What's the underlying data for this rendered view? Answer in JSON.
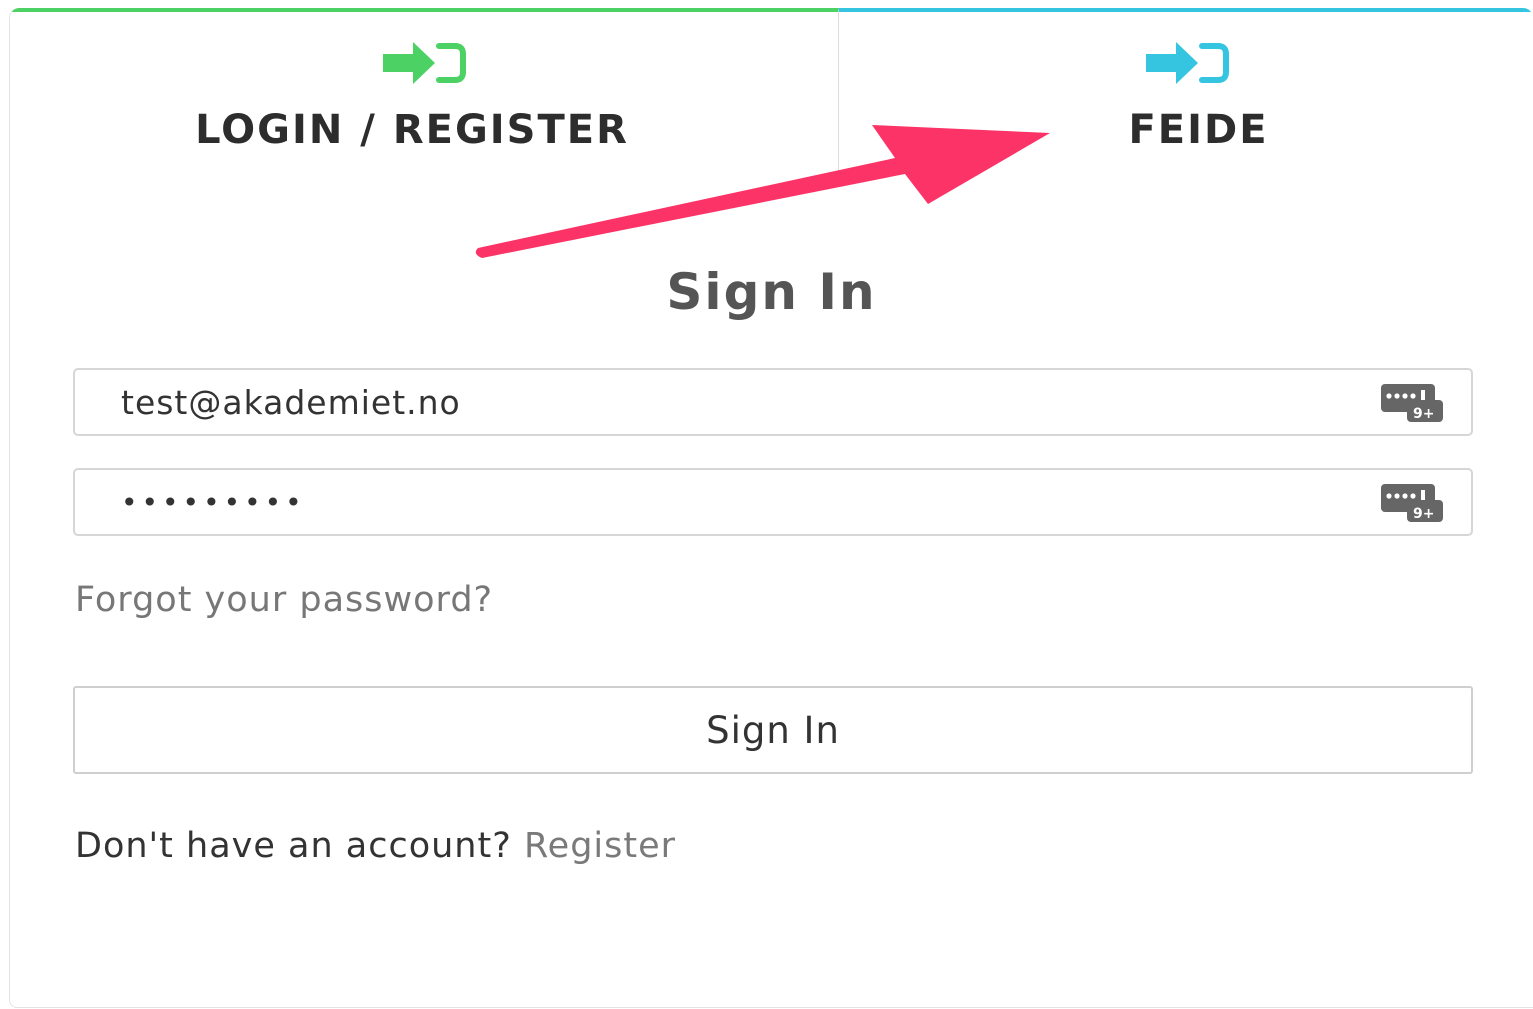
{
  "colors": {
    "login_tab_accent": "#4cd264",
    "feide_tab_accent": "#35c5e0",
    "annotation_arrow": "#fc3366",
    "icon_gray": "#666666"
  },
  "tabs": {
    "login": {
      "label": "LOGIN / REGISTER",
      "icon": "sign-in-icon"
    },
    "feide": {
      "label": "FEIDE",
      "icon": "sign-in-icon"
    }
  },
  "annotation": {
    "icon": "arrow-annotation",
    "points_to": "feide"
  },
  "form": {
    "heading": "Sign In",
    "email": {
      "value": "test@akademiet.no",
      "icon": "keyboard-icon"
    },
    "password": {
      "value": "•••••••••",
      "icon": "keyboard-icon"
    },
    "forgot_link": "Forgot your password?",
    "submit_label": "Sign In",
    "register_prompt": "Don't have an account?",
    "register_link": "Register"
  }
}
